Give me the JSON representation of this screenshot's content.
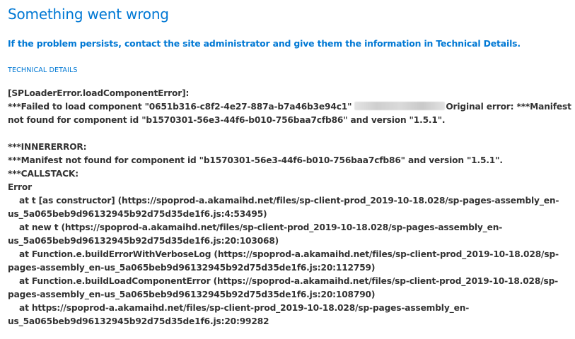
{
  "error_page": {
    "title": "Something went wrong",
    "subtitle": "If the problem persists, contact the site administrator and give them the information in Technical Details.",
    "technical_details_label": "TECHNICAL DETAILS"
  },
  "details": {
    "loader_error": "[SPLoaderError.loadComponentError]:",
    "failed_prefix": "***Failed to load component \"0651b316-c8f2-4e27-887a-b7a46b3e94c1\"",
    "original_error": "Original error: ***Manifest",
    "failed_line2": "not found for component id \"b1570301-56e3-44f6-b010-756baa7cfb86\" and version \"1.5.1\".",
    "innererror_label": "***INNERERROR:",
    "innererror_msg": "***Manifest not found for component id \"b1570301-56e3-44f6-b010-756baa7cfb86\" and version \"1.5.1\".",
    "callstack_label": "***CALLSTACK:",
    "error_label": "Error",
    "stack": [
      {
        "line1": "at t [as constructor] (https://spoprod-a.akamaihd.net/files/sp-client-prod_2019-10-18.028/sp-pages-assembly_en-",
        "line2": "us_5a065beb9d96132945b92d75d35de1f6.js:4:53495)"
      },
      {
        "line1": "at new t (https://spoprod-a.akamaihd.net/files/sp-client-prod_2019-10-18.028/sp-pages-assembly_en-",
        "line2": "us_5a065beb9d96132945b92d75d35de1f6.js:20:103068)"
      },
      {
        "line1": "at Function.e.buildErrorWithVerboseLog (https://spoprod-a.akamaihd.net/files/sp-client-prod_2019-10-18.028/sp-",
        "line2": "pages-assembly_en-us_5a065beb9d96132945b92d75d35de1f6.js:20:112759)"
      },
      {
        "line1": "at Function.e.buildLoadComponentError (https://spoprod-a.akamaihd.net/files/sp-client-prod_2019-10-18.028/sp-",
        "line2": "pages-assembly_en-us_5a065beb9d96132945b92d75d35de1f6.js:20:108790)"
      },
      {
        "line1": "at https://spoprod-a.akamaihd.net/files/sp-client-prod_2019-10-18.028/sp-pages-assembly_en-",
        "line2": "us_5a065beb9d96132945b92d75d35de1f6.js:20:99282"
      }
    ]
  },
  "colors": {
    "accent": "#0078d4",
    "body_text": "#333333",
    "background": "#ffffff"
  }
}
